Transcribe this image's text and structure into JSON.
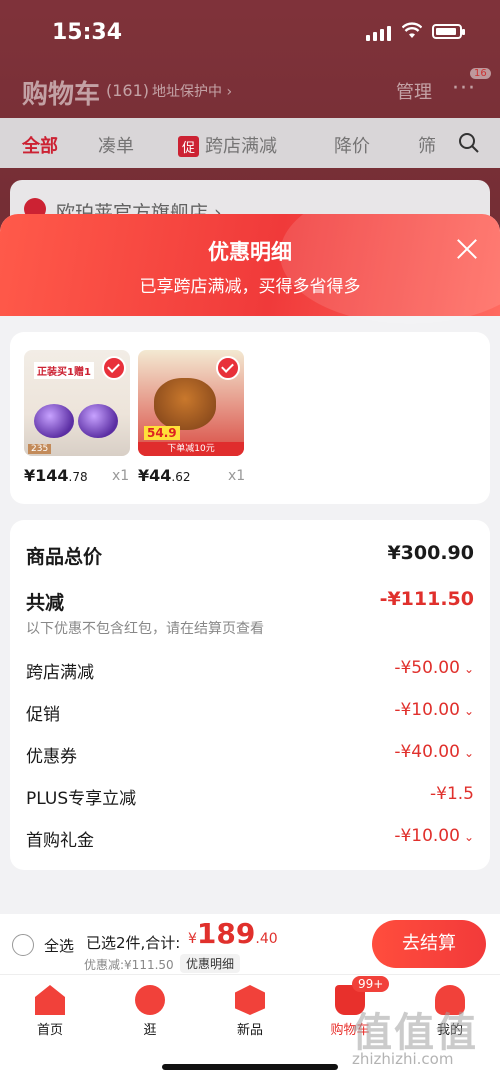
{
  "status_bar": {
    "time": "15:34"
  },
  "cart_page": {
    "title": "购物车",
    "count": "(161)",
    "address": "地址保护中 ›",
    "manage": "管理",
    "more": "···",
    "more_badge": "16",
    "filters": [
      "全部",
      "凑单",
      "跨店满减",
      "降价",
      "筛"
    ],
    "promo_tag": "促",
    "store_name": "欧珀莱官方旗舰店 ›"
  },
  "sheet": {
    "title": "优惠明细",
    "subtitle": "已享跨店满减，买得多省得多",
    "products": [
      {
        "price_main": "¥144",
        "price_dec": ".78",
        "qty": "x1",
        "label": "正装买1赠1",
        "tag": "235",
        "icon": "cream-jar-image"
      },
      {
        "price_main": "¥44",
        "price_dec": ".62",
        "qty": "x1",
        "label": "54.9",
        "tag": "下单减10元",
        "icon": "braised-food-image"
      }
    ],
    "summary": {
      "total_label": "商品总价",
      "total_value": "¥300.90",
      "discount_label": "共减",
      "discount_value": "-¥111.50",
      "note": "以下优惠不包含红包，请在结算页查看",
      "items": [
        {
          "label": "跨店满减",
          "value": "-¥50.00",
          "chevron": "⌄"
        },
        {
          "label": "促销",
          "value": "-¥10.00",
          "chevron": "⌄"
        },
        {
          "label": "优惠券",
          "value": "-¥40.00",
          "chevron": "⌄"
        },
        {
          "label": "PLUS专享立减",
          "value": "-¥1.5",
          "chevron": ""
        },
        {
          "label": "首购礼金",
          "value": "-¥10.00",
          "chevron": "⌄"
        }
      ]
    }
  },
  "bottom_bar": {
    "select_all": "全选",
    "picked": "已选2件,合计:",
    "currency": "¥",
    "total_int": "189",
    "total_dec": ".40",
    "savings": "优惠减:¥111.50",
    "detail": "优惠明细",
    "checkout": "去结算"
  },
  "tabbar": {
    "items": [
      "首页",
      "逛",
      "新品",
      "购物车",
      "我的"
    ],
    "cart_badge": "99+"
  },
  "watermark": {
    "main": "值值值",
    "sub": "zhizhizhi.com"
  },
  "colors": {
    "accent": "#e8302c",
    "header_gradient_start": "#ff5a4a"
  }
}
